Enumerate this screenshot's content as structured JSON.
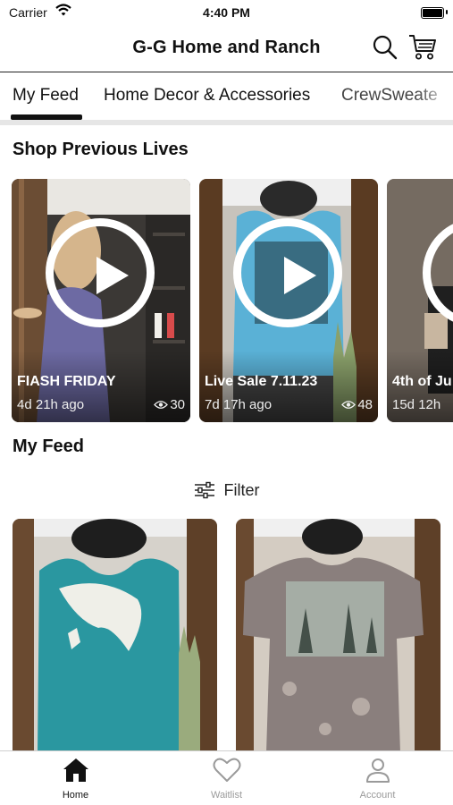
{
  "status_bar": {
    "carrier": "Carrier",
    "time": "4:40 PM"
  },
  "header": {
    "title": "G-G Home and Ranch",
    "search_icon": "search-icon",
    "cart_icon": "cart-icon"
  },
  "tabs": [
    {
      "label": "My Feed",
      "active": true
    },
    {
      "label": "Home Decor & Accessories",
      "active": false
    },
    {
      "label": "CrewSweate",
      "active": false
    }
  ],
  "previous_lives": {
    "title": "Shop Previous Lives",
    "items": [
      {
        "name": "FIASH FRIDAY",
        "age": "4d 21h ago",
        "views": "30"
      },
      {
        "name": "Live Sale 7.11.23",
        "age": "7d 17h ago",
        "views": "48"
      },
      {
        "name": "4th of Ju",
        "age": "15d 12h",
        "views": ""
      }
    ]
  },
  "feed": {
    "title": "My Feed",
    "filter_label": "Filter"
  },
  "bottom_tabs": [
    {
      "label": "Home",
      "icon": "home-icon",
      "active": true
    },
    {
      "label": "Waitlist",
      "icon": "heart-icon",
      "active": false
    },
    {
      "label": "Account",
      "icon": "person-icon",
      "active": false
    }
  ],
  "colors": {
    "accent": "#111111",
    "inactive": "#9a9a9a",
    "tab_divider": "#e6e6e6"
  }
}
